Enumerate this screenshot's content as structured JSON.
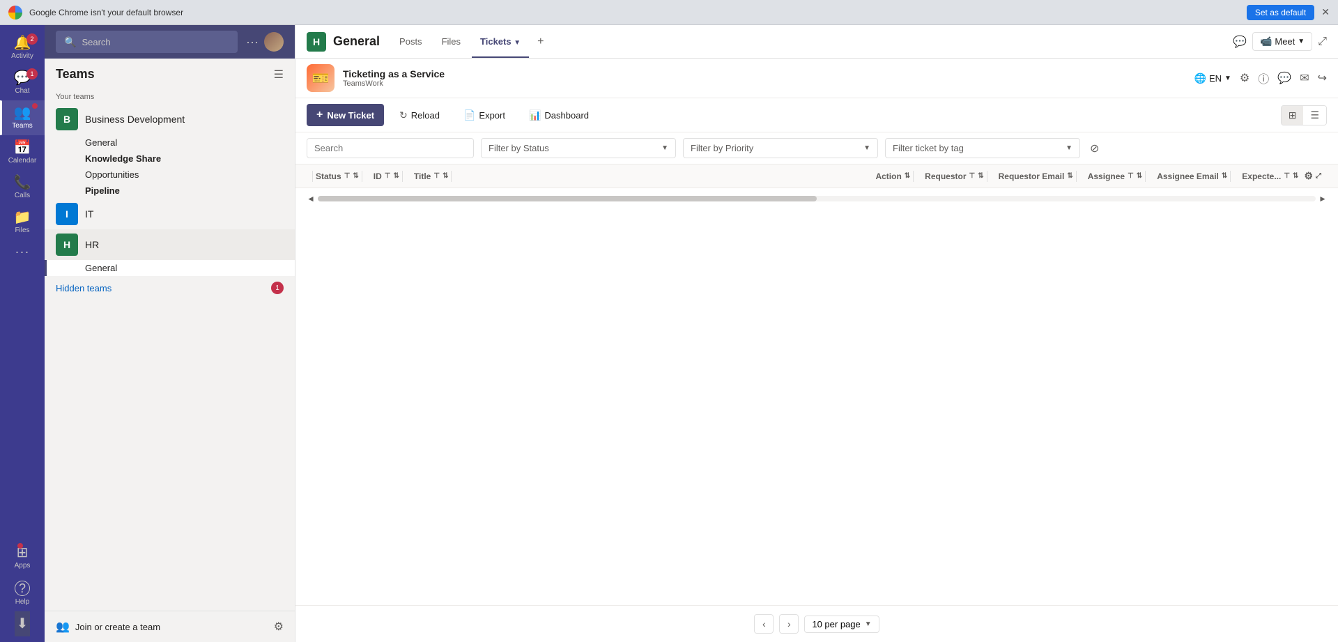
{
  "chrome": {
    "warning": "Google Chrome isn't your default browser",
    "default_btn": "Set as default",
    "close": "✕"
  },
  "nav": {
    "items": [
      {
        "id": "activity",
        "label": "Activity",
        "icon": "🔔",
        "badge": "2",
        "has_badge": true
      },
      {
        "id": "chat",
        "label": "Chat",
        "icon": "💬",
        "badge": "1",
        "has_badge": true
      },
      {
        "id": "teams",
        "label": "Teams",
        "icon": "👥",
        "has_dot": true,
        "active": true
      },
      {
        "id": "calendar",
        "label": "Calendar",
        "icon": "📅"
      },
      {
        "id": "calls",
        "label": "Calls",
        "icon": "📞"
      },
      {
        "id": "files",
        "label": "Files",
        "icon": "📁"
      },
      {
        "id": "more",
        "label": "···",
        "icon": "···"
      }
    ],
    "bottom": [
      {
        "id": "apps",
        "label": "Apps",
        "icon": "⊞",
        "has_dot": true
      },
      {
        "id": "help",
        "label": "Help",
        "icon": "?"
      },
      {
        "id": "download",
        "label": "",
        "icon": "⬇"
      }
    ]
  },
  "teams_panel": {
    "title": "Teams",
    "your_teams_label": "Your teams",
    "teams": [
      {
        "id": "business-dev",
        "name": "Business Development",
        "initial": "B",
        "color": "#237b4b",
        "channels": [
          "General",
          "Knowledge Share",
          "Opportunities",
          "Pipeline"
        ]
      },
      {
        "id": "it",
        "name": "IT",
        "initial": "I",
        "color": "#0078d4"
      },
      {
        "id": "hr",
        "name": "HR",
        "initial": "H",
        "color": "#237b4b",
        "channels": [
          "General"
        ]
      }
    ],
    "hidden_teams": "Hidden teams",
    "hidden_badge": "1",
    "join_label": "Join or create a team"
  },
  "channel_header": {
    "channel_initial": "H",
    "channel_name": "General",
    "tabs": [
      "Posts",
      "Files",
      "Tickets"
    ],
    "active_tab": "Tickets",
    "meet_label": "Meet"
  },
  "app": {
    "name": "Ticketing as a Service",
    "sub": "TeamsWork",
    "logo_emoji": "🎫",
    "lang": "EN"
  },
  "toolbar": {
    "new_ticket": "New Ticket",
    "reload": "Reload",
    "export": "Export",
    "dashboard": "Dashboard"
  },
  "filters": {
    "search_placeholder": "Search",
    "status_placeholder": "Filter by Status",
    "priority_placeholder": "Filter by Priority",
    "tag_placeholder": "Filter ticket by tag"
  },
  "table": {
    "columns": [
      {
        "label": "Status",
        "has_filter": true,
        "has_sort": true
      },
      {
        "label": "ID",
        "has_filter": true,
        "has_sort": true
      },
      {
        "label": "Title",
        "has_filter": true,
        "has_sort": true
      },
      {
        "label": "Action",
        "has_sort": true
      },
      {
        "label": "Requestor",
        "has_filter": true,
        "has_sort": true
      },
      {
        "label": "Requestor Email",
        "has_sort": true
      },
      {
        "label": "Assignee",
        "has_filter": true,
        "has_sort": true
      },
      {
        "label": "Assignee Email",
        "has_sort": true
      },
      {
        "label": "Expecte...",
        "has_filter": true,
        "has_sort": true
      }
    ]
  },
  "pagination": {
    "per_page": "10 per page",
    "prev": "‹",
    "next": "›"
  },
  "search": {
    "placeholder": "Search",
    "value": ""
  },
  "top_bar": {
    "search_placeholder": "Search"
  }
}
